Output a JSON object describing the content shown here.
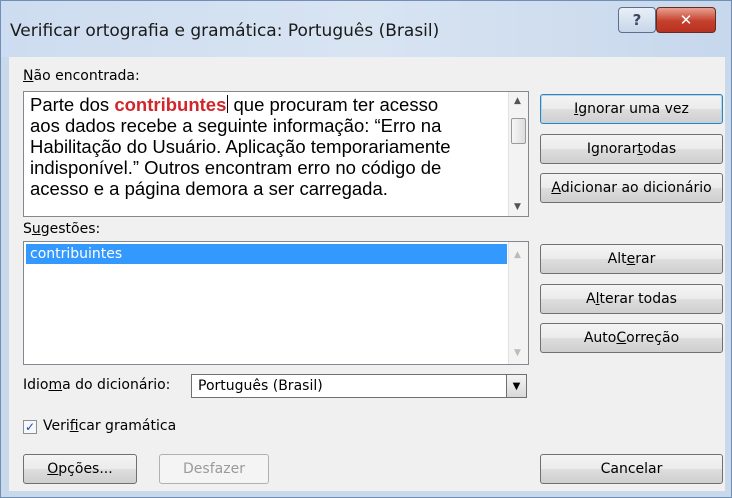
{
  "window": {
    "title": "Verificar ortografia e gramática: Português (Brasil)",
    "help_glyph": "?",
    "close_glyph": "✕"
  },
  "not_found": {
    "label_first": "N",
    "label_rest": "ão encontrada:",
    "text_before": "Parte dos ",
    "error_word": "contribuntes",
    "text_after": " que procuram ter acesso\naos dados recebe a seguinte informação: “Erro na\nHabilitação do Usuário. Aplicação temporariamente\nindisponível.” Outros encontram erro no código de\nacesso e a página demora a ser carregada."
  },
  "suggestions": {
    "label_pre": "S",
    "label_key": "u",
    "label_rest": "gestões:",
    "items": [
      "contribuintes"
    ]
  },
  "buttons": {
    "ignore_once": {
      "pre": "",
      "key": "I",
      "post": "gnorar uma vez"
    },
    "ignore_all": {
      "pre": "Ignorar ",
      "key": "t",
      "post": "odas"
    },
    "add_dictionary": {
      "pre": "",
      "key": "A",
      "post": "dicionar ao dicionário"
    },
    "change": {
      "pre": "Alt",
      "key": "e",
      "post": "rar"
    },
    "change_all": {
      "pre": "A",
      "key": "l",
      "post": "terar todas"
    },
    "autocorrect": {
      "pre": "Auto",
      "key": "C",
      "post": "orreção"
    },
    "options": {
      "pre": "",
      "key": "O",
      "post": "pções..."
    },
    "undo": {
      "label": "Desfazer"
    },
    "cancel": {
      "label": "Cancelar"
    }
  },
  "dictionary": {
    "label_pre": "Idio",
    "label_key": "m",
    "label_post": "a do dicionário:",
    "value": "Português (Brasil)"
  },
  "grammar": {
    "label_pre": "Veri",
    "label_key": "f",
    "label_post": "icar gramática",
    "checked": true
  }
}
